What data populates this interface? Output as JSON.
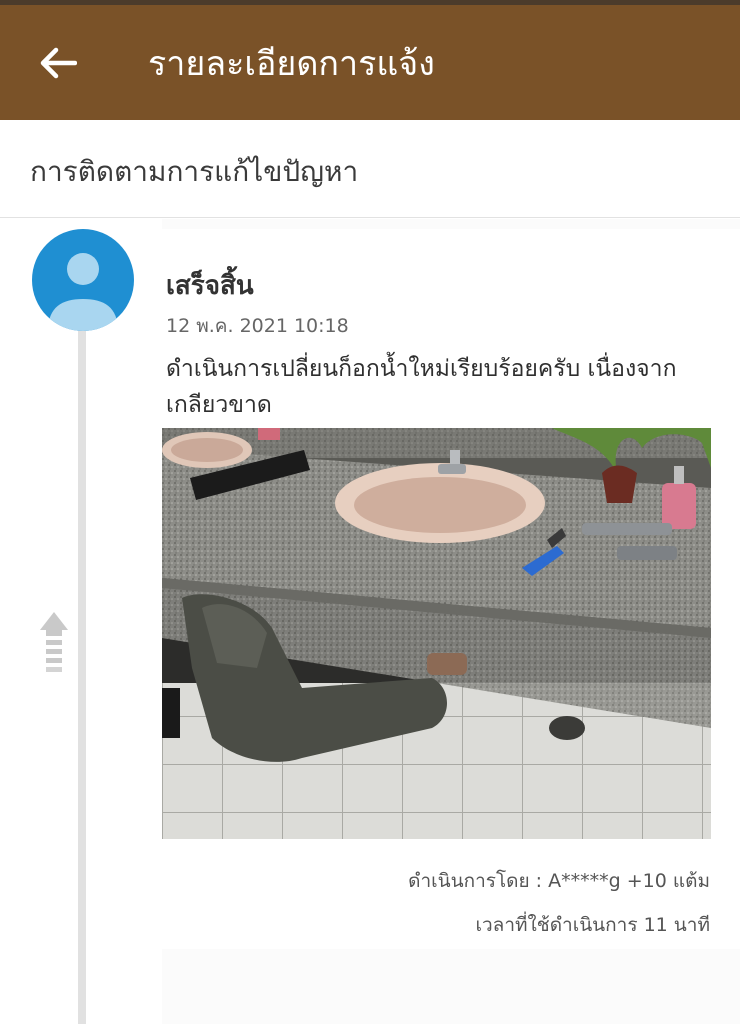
{
  "header": {
    "title": "รายละเอียดการแจ้ง",
    "back_icon": "arrow-left-icon",
    "background_color": "#7a5228"
  },
  "section": {
    "title": "การติดตามการแก้ไขปัญหา"
  },
  "timeline": {
    "entries": [
      {
        "avatar_icon": "user-avatar-icon",
        "status": "เสร็จสิ้น",
        "datetime": "12 พ.ค. 2021 10:18",
        "description": "ดำเนินการเปลี่ยนก็อกน้ำใหม่เรียบร้อยครับ เนื่องจากเกลียวขาด",
        "photo": "photo-of-technician-fixing-sink-faucet",
        "performed_by_label": "ดำเนินการโดย :",
        "performed_by_user": "A*****g",
        "points": "+10 แต้ม",
        "duration_label": "เวลาที่ใช้ดำเนินการ",
        "duration_value": "11 นาที"
      }
    ],
    "scroll_icon": "scroll-up-arrow-icon"
  }
}
